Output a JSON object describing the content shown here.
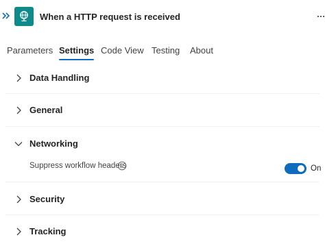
{
  "header": {
    "title": "When a HTTP request is received",
    "expand_icon": "double-chevron-right-icon",
    "trigger_icon": "http-request-globe-icon",
    "more_icon": "more-options-icon",
    "accent_color": "#0f8a8a"
  },
  "tabs": [
    {
      "label": "Parameters",
      "active": false
    },
    {
      "label": "Settings",
      "active": true
    },
    {
      "label": "Code View",
      "active": false
    },
    {
      "label": "Testing",
      "active": false
    },
    {
      "label": "About",
      "active": false
    }
  ],
  "sections": [
    {
      "label": "Data Handling",
      "expanded": false
    },
    {
      "label": "General",
      "expanded": false
    },
    {
      "label": "Networking",
      "expanded": true
    },
    {
      "label": "Security",
      "expanded": false
    },
    {
      "label": "Tracking",
      "expanded": false
    }
  ],
  "networking": {
    "setting_label": "Suppress workflow headers",
    "info_icon": "info-icon",
    "toggle_state": "On",
    "toggle_on": true,
    "toggle_color": "#0f6cbd"
  }
}
